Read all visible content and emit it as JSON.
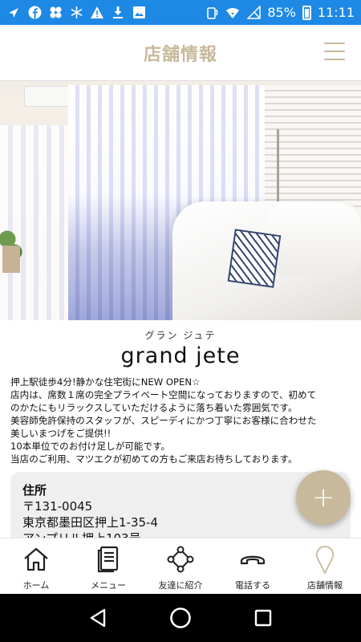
{
  "status_bar": {
    "battery": "85%",
    "time": "11:11",
    "icons": [
      "navigation-icon",
      "facebook-icon",
      "pinwheel-icon",
      "snowflake-icon",
      "warning-icon",
      "download-icon",
      "image-icon",
      "nfc-icon",
      "wifi-icon",
      "no-signal-icon",
      "battery-icon"
    ]
  },
  "header": {
    "title": "店舗情報"
  },
  "store": {
    "kana": "グラン ジュテ",
    "name": "grand jete",
    "description": [
      "押上駅徒歩4分!静かな住宅街にNEW OPEN☆",
      "店内は、席数１席の完全プライベート空間になっておりますので、初めて",
      "のかたにもリラックスしていただけるように落ち着いた雰囲気です。",
      "美容師免許保持のスタッフが、スピーディにかつ丁寧にお客様に合わせた",
      "美しいまつげをご提供!!",
      "10本単位でのお付け足しが可能です。",
      "当店のご利用、マツエクが初めての方もご来店お待ちしております。"
    ]
  },
  "address": {
    "label": "住所",
    "postal": "〒131-0045",
    "line1": "東京都墨田区押上1-35-4",
    "line2": "アンプリル押上103号"
  },
  "fab": {
    "symbol": "+"
  },
  "bottom_nav": {
    "items": [
      {
        "label": "ホーム",
        "icon": "home-icon"
      },
      {
        "label": "メニュー",
        "icon": "book-icon"
      },
      {
        "label": "友達に紹介",
        "icon": "share-network-icon"
      },
      {
        "label": "電話する",
        "icon": "phone-icon"
      },
      {
        "label": "店舗情報",
        "icon": "location-pin-icon"
      }
    ]
  },
  "colors": {
    "accent": "#c8b99c",
    "status_bar": "#1e88e5"
  }
}
